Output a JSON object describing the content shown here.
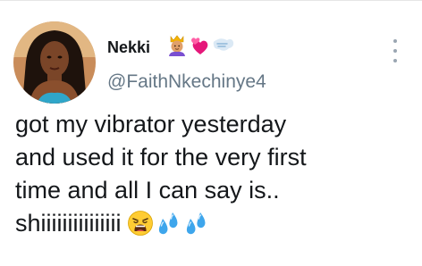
{
  "tweet": {
    "author": {
      "display_name": "Nekki",
      "handle": "@FaithNkechinye4",
      "name_emojis": [
        "prince-emoji",
        "two-hearts-emoji",
        "wind-blowing-emoji"
      ]
    },
    "body_lines": [
      "got my vibrator yesterday",
      "and used it for the very first",
      "time and all I can say is..",
      "shiiiiiiiiiiiiiii"
    ],
    "body_emojis": [
      "weary-face-emoji",
      "sweat-droplets-emoji",
      "sweat-droplets-emoji"
    ]
  },
  "colors": {
    "name_text": "#14171a",
    "handle_text": "#657786",
    "body_text": "#14171a"
  }
}
